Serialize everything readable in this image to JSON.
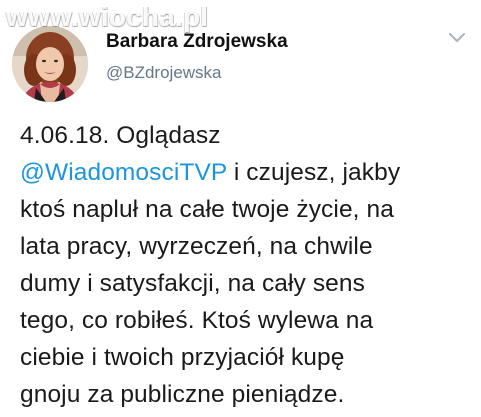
{
  "watermark": {
    "text": "www.wiocha.pl"
  },
  "tweet": {
    "author": {
      "display_name": "Barbara Zdrojewska",
      "username": "@BZdrojewska",
      "avatar_icon": "profile-photo"
    },
    "menu_icon": "chevron-down-icon",
    "text": {
      "line1": "4.06.18. Oglądasz",
      "mention": "@WiadomosciTVP",
      "line2_rest": " i czujesz, jakby",
      "line3": "ktoś napluł na całe twoje życie, na",
      "line4": "lata pracy, wyrzeczeń, na chwile",
      "line5": "dumy i satysfakcji, na cały sens",
      "line6": "tego, co robiłeś. Ktoś wylewa na",
      "line7": "ciebie i twoich przyjaciół kupę",
      "line8": "gnoju za publiczne pieniądze."
    }
  },
  "colors": {
    "mention": "#1b95e0",
    "username": "#657786",
    "text": "#1a1a1a"
  }
}
